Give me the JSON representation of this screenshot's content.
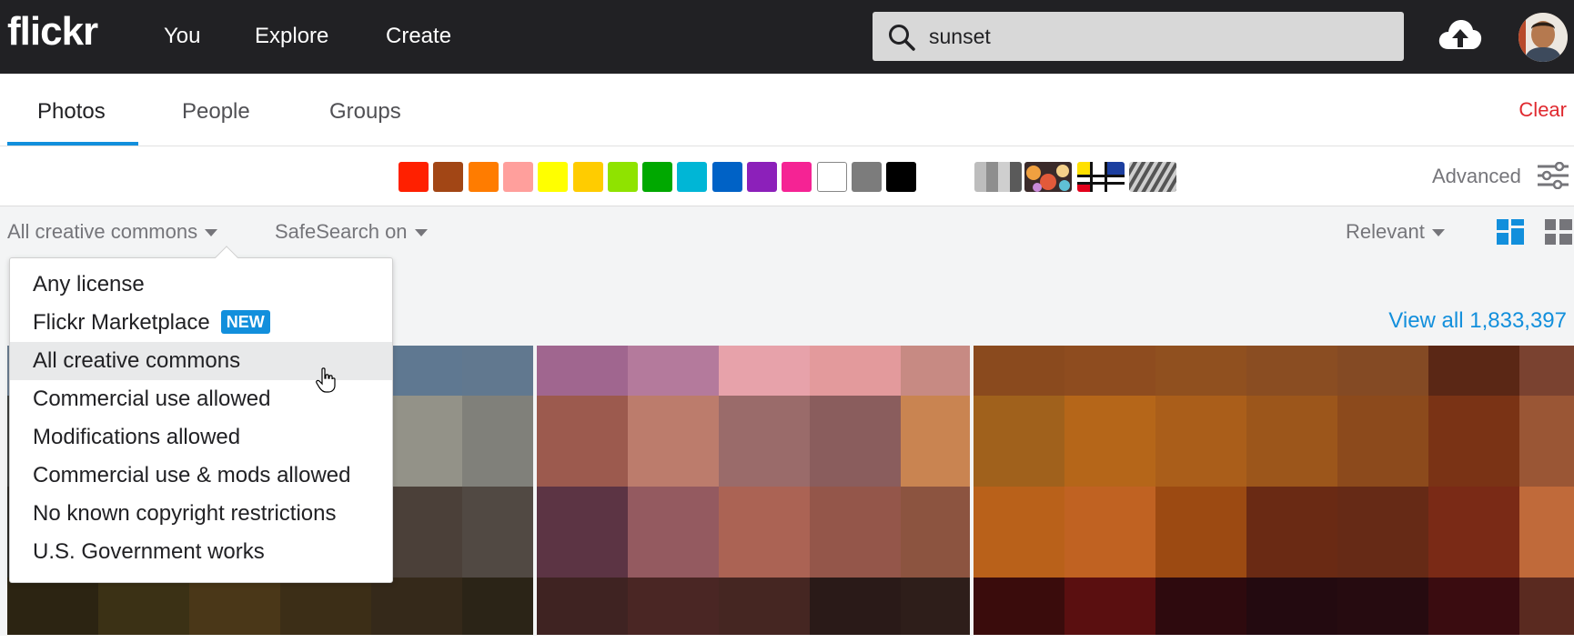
{
  "header": {
    "logo": "flickr",
    "nav": [
      "You",
      "Explore",
      "Create"
    ],
    "search_value": "sunset",
    "search_icon": "search-icon",
    "upload_icon": "cloud-upload-icon",
    "avatar": "user-avatar"
  },
  "tabs": {
    "items": [
      "Photos",
      "People",
      "Groups"
    ],
    "active": "Photos",
    "clear": "Clear"
  },
  "color_filters": {
    "colors": [
      "#ff2000",
      "#a24615",
      "#ff7c00",
      "#ff9f9c",
      "#ffff00",
      "#ffcc00",
      "#8fe300",
      "#00a800",
      "#00b6d6",
      "#0062c6",
      "#8c20ba",
      "#f52394",
      "#ffffff",
      "#7c7c7c",
      "#000000"
    ],
    "styles": [
      "black-and-white",
      "shallow-depth-of-field",
      "minimalist",
      "patterns"
    ],
    "advanced": "Advanced"
  },
  "filters": {
    "license": "All creative commons",
    "safesearch": "SafeSearch on",
    "sort": "Relevant",
    "view_all": "View all 1,833,397"
  },
  "license_menu": {
    "items": [
      "Any license",
      "Flickr Marketplace",
      "All creative commons",
      "Commercial use allowed",
      "Modifications allowed",
      "Commercial use & mods allowed",
      "No known copyright restrictions",
      "U.S. Government works"
    ],
    "new_badge": "NEW",
    "highlighted": "All creative commons"
  },
  "accent_colors": {
    "topbar": "#212124",
    "link": "#128fdc",
    "clear": "#e0292f"
  }
}
